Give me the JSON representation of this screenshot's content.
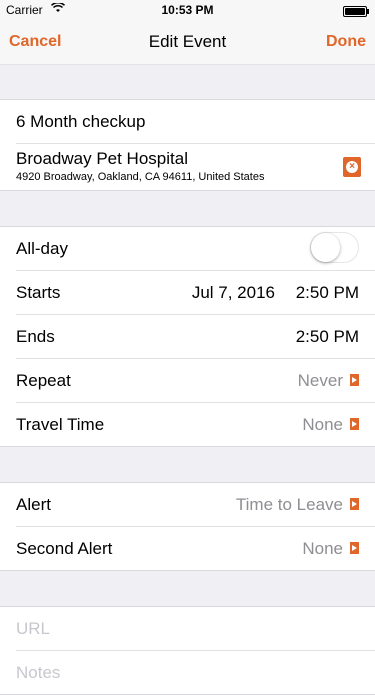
{
  "status_bar": {
    "carrier": "Carrier",
    "time": "10:53 PM"
  },
  "nav": {
    "cancel_label": "Cancel",
    "title": "Edit Event",
    "done_label": "Done"
  },
  "event": {
    "title": "6 Month checkup",
    "location_name": "Broadway Pet Hospital",
    "location_address": "4920 Broadway, Oakland, CA  94611, United States"
  },
  "schedule": {
    "allday_label": "All-day",
    "allday_on": false,
    "starts_label": "Starts",
    "starts_date": "Jul 7, 2016",
    "starts_time": "2:50 PM",
    "ends_label": "Ends",
    "ends_time": "2:50 PM",
    "repeat_label": "Repeat",
    "repeat_value": "Never",
    "travel_label": "Travel Time",
    "travel_value": "None"
  },
  "alerts": {
    "alert_label": "Alert",
    "alert_value": "Time to Leave",
    "second_label": "Second Alert",
    "second_value": "None"
  },
  "extra": {
    "url_placeholder": "URL",
    "notes_placeholder": "Notes"
  },
  "colors": {
    "accent": "#e0662a"
  }
}
